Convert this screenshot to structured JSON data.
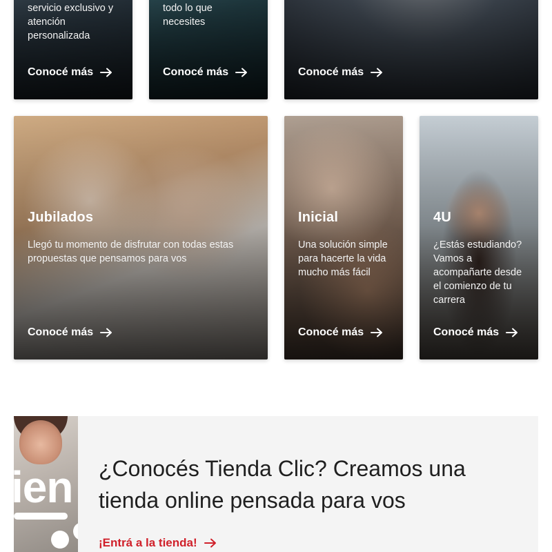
{
  "cards_top": [
    {
      "description": "proyectos con un servicio exclusivo y atención personalizada",
      "cta": "Conocé más"
    },
    {
      "description": "acompañarte en todo lo que necesites",
      "cta": "Conocé más"
    },
    {
      "cta": "Conocé más"
    }
  ],
  "cards": [
    {
      "title": "Jubilados",
      "description": "Llegó tu momento de disfrutar con todas estas propuestas que pensamos para vos",
      "cta": "Conocé más"
    },
    {
      "title": "Inicial",
      "description": "Una solución simple para hacerte la vida mucho más fácil",
      "cta": "Conocé más"
    },
    {
      "title": "4U",
      "description": "¿Estás estudiando? Vamos a acompañarte desde el comienzo de tu carrera",
      "cta": "Conocé más"
    }
  ],
  "banner": {
    "image_text": "ien",
    "headline": "¿Conocés Tienda Clic? Creamos una tienda online pensada para vos",
    "link": "¡Entrá a la tienda!"
  },
  "colors": {
    "accent": "#d0202a",
    "banner_bg": "#f4f4f4"
  },
  "icons": {
    "cta_arrow": "arrow-right-icon"
  }
}
